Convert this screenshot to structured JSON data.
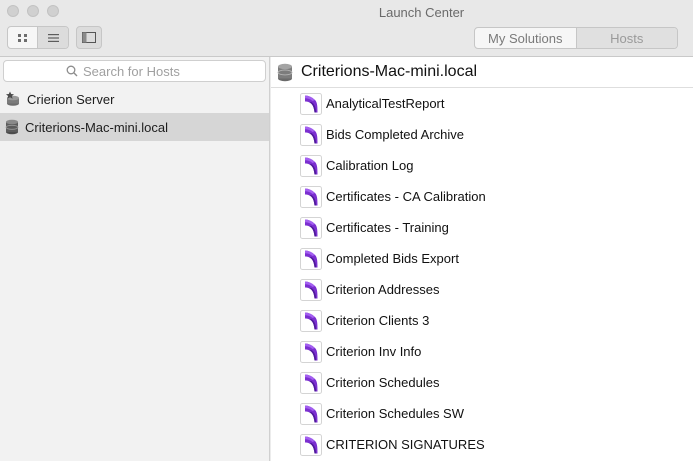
{
  "window": {
    "title": "Launch Center"
  },
  "toolbar": {
    "view_grid": "grid-view",
    "view_list": "list-view",
    "sidebar_toggle": "sidebar-toggle"
  },
  "segment": {
    "my_solutions": "My Solutions",
    "hosts": "Hosts"
  },
  "sidebar": {
    "search_placeholder": "Search for Hosts",
    "hosts": [
      {
        "label": "Crierion Server"
      },
      {
        "label": "Criterions-Mac-mini.local"
      }
    ]
  },
  "main": {
    "host_title": "Criterions-Mac-mini.local",
    "files": [
      {
        "label": "AnalyticalTestReport"
      },
      {
        "label": "Bids Completed Archive"
      },
      {
        "label": "Calibration Log"
      },
      {
        "label": "Certificates - CA Calibration"
      },
      {
        "label": "Certificates - Training"
      },
      {
        "label": "Completed Bids Export"
      },
      {
        "label": "Criterion Addresses"
      },
      {
        "label": "Criterion Clients 3"
      },
      {
        "label": "Criterion Inv Info"
      },
      {
        "label": "Criterion Schedules"
      },
      {
        "label": "Criterion Schedules SW"
      },
      {
        "label": "CRITERION SIGNATURES"
      }
    ]
  }
}
